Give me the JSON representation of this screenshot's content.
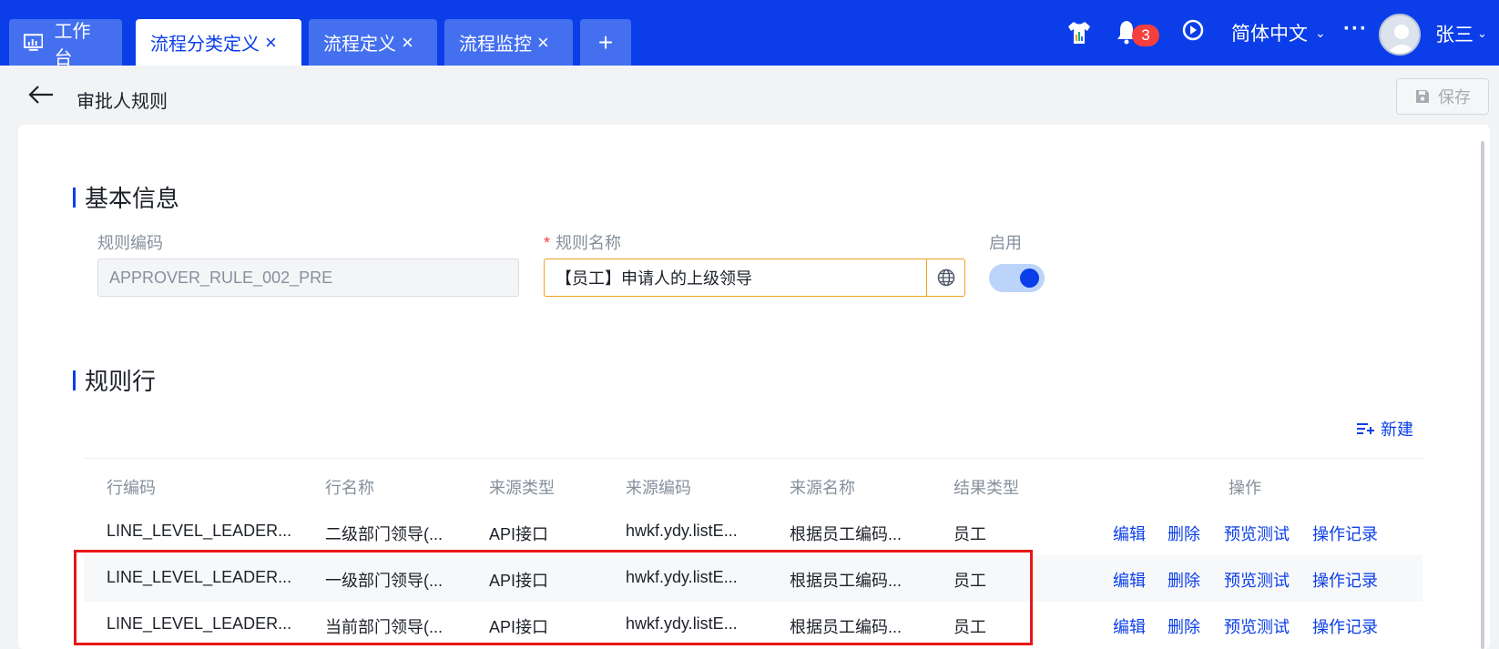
{
  "tabs": [
    {
      "label": "工作台",
      "active": false,
      "closable": false,
      "icon": "monitor-icon"
    },
    {
      "label": "流程分类定义",
      "active": true,
      "closable": true
    },
    {
      "label": "流程定义",
      "active": false,
      "closable": true
    },
    {
      "label": "流程监控",
      "active": false,
      "closable": true
    }
  ],
  "tab_add_label": "+",
  "tab_close_glyph": "×",
  "topbar": {
    "notification_count": "3",
    "language": "简体中文",
    "more_glyph": "···",
    "username": "张三",
    "chevron_glyph": "⌄"
  },
  "header": {
    "title": "审批人规则",
    "save_label": "保存"
  },
  "basic_info": {
    "section_title": "基本信息",
    "code_label": "规则编码",
    "code_value": "APPROVER_RULE_002_PRE",
    "name_label": "规则名称",
    "name_required_mark": "*",
    "name_value": "【员工】申请人的上级领导",
    "enable_label": "启用",
    "enabled": true
  },
  "rule_lines": {
    "section_title": "规则行",
    "new_label": "新建",
    "columns": [
      "行编码",
      "行名称",
      "来源类型",
      "来源编码",
      "来源名称",
      "结果类型",
      "操作"
    ],
    "rows": [
      {
        "code": "LINE_LEVEL_LEADER...",
        "name": "二级部门领导(...",
        "source_type": "API接口",
        "source_code": "hwkf.ydy.listE...",
        "source_name": "根据员工编码...",
        "result_type": "员工"
      },
      {
        "code": "LINE_LEVEL_LEADER...",
        "name": "一级部门领导(...",
        "source_type": "API接口",
        "source_code": "hwkf.ydy.listE...",
        "source_name": "根据员工编码...",
        "result_type": "员工"
      },
      {
        "code": "LINE_LEVEL_LEADER...",
        "name": "当前部门领导(...",
        "source_type": "API接口",
        "source_code": "hwkf.ydy.listE...",
        "source_name": "根据员工编码...",
        "result_type": "员工"
      }
    ],
    "actions": [
      "编辑",
      "删除",
      "预览测试",
      "操作记录"
    ]
  },
  "colors": {
    "brand": "#0b3ee8",
    "highlight": "#e81616",
    "badge": "#f53f3f"
  }
}
